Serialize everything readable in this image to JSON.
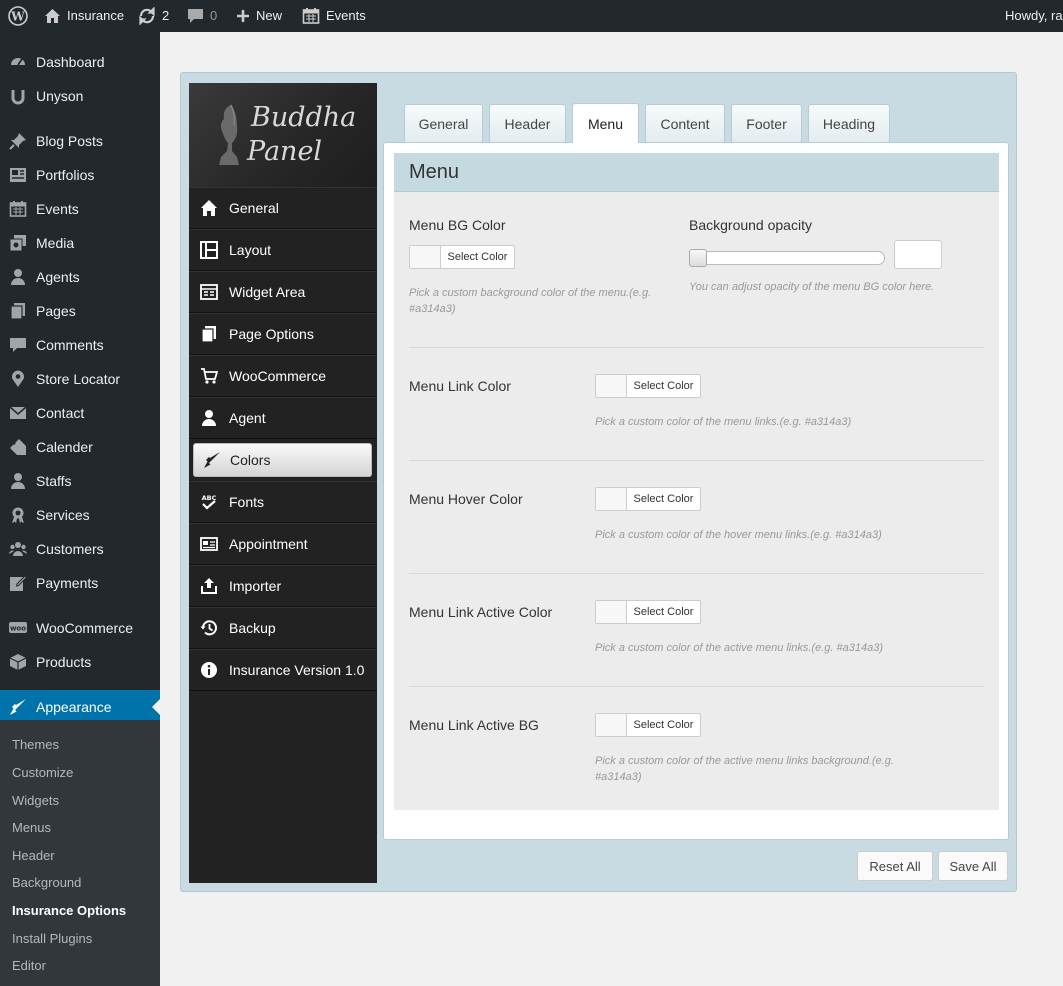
{
  "adminbar": {
    "site_name": "Insurance",
    "updates_count": "2",
    "comments_count": "0",
    "new_label": "New",
    "events_label": "Events",
    "howdy": "Howdy, ra"
  },
  "admin_menu": {
    "items": [
      {
        "label": "Dashboard",
        "icon": "dashboard-icon"
      },
      {
        "label": "Unyson",
        "icon": "unyson-icon"
      },
      {
        "label": "Blog Posts",
        "icon": "pin-icon"
      },
      {
        "label": "Portfolios",
        "icon": "portfolio-icon"
      },
      {
        "label": "Events",
        "icon": "calendar-icon"
      },
      {
        "label": "Media",
        "icon": "media-icon"
      },
      {
        "label": "Agents",
        "icon": "user-icon"
      },
      {
        "label": "Pages",
        "icon": "pages-icon"
      },
      {
        "label": "Comments",
        "icon": "comment-icon"
      },
      {
        "label": "Store Locator",
        "icon": "location-icon"
      },
      {
        "label": "Contact",
        "icon": "email-icon"
      },
      {
        "label": "Calender",
        "icon": "tag-icon"
      },
      {
        "label": "Staffs",
        "icon": "user-icon"
      },
      {
        "label": "Services",
        "icon": "award-icon"
      },
      {
        "label": "Customers",
        "icon": "groups-icon"
      },
      {
        "label": "Payments",
        "icon": "edit-icon"
      },
      {
        "label": "WooCommerce",
        "icon": "woo-icon"
      },
      {
        "label": "Products",
        "icon": "cube-icon"
      },
      {
        "label": "Appearance",
        "icon": "brush-icon"
      }
    ],
    "submenu": [
      "Themes",
      "Customize",
      "Widgets",
      "Menus",
      "Header",
      "Background",
      "Insurance Options",
      "Install Plugins",
      "Editor"
    ],
    "current_submenu": "Insurance Options"
  },
  "panel": {
    "logo_line1": "Buddha",
    "logo_line2": "Panel",
    "nav": [
      {
        "label": "General",
        "icon": "home-icon"
      },
      {
        "label": "Layout",
        "icon": "layout-icon"
      },
      {
        "label": "Widget Area",
        "icon": "widget-icon"
      },
      {
        "label": "Page Options",
        "icon": "pages-icon"
      },
      {
        "label": "WooCommerce",
        "icon": "cart-icon"
      },
      {
        "label": "Agent",
        "icon": "user-icon"
      },
      {
        "label": "Colors",
        "icon": "brush-icon"
      },
      {
        "label": "Fonts",
        "icon": "spellcheck-icon"
      },
      {
        "label": "Appointment",
        "icon": "card-icon"
      },
      {
        "label": "Importer",
        "icon": "upload-icon"
      },
      {
        "label": "Backup",
        "icon": "history-icon"
      },
      {
        "label": "Insurance Version 1.0",
        "icon": "info-icon"
      }
    ],
    "active_nav": "Colors",
    "tabs": [
      "General",
      "Header",
      "Menu",
      "Content",
      "Footer",
      "Heading"
    ],
    "active_tab": "Menu",
    "section_title": "Menu",
    "options": {
      "bg_color": {
        "label": "Menu BG Color",
        "button": "Select Color",
        "desc": "Pick a custom background color of the menu.(e.g. #a314a3)"
      },
      "opacity": {
        "label": "Background opacity",
        "desc": "You can adjust opacity of the menu BG color here."
      },
      "link_color": {
        "label": "Menu Link Color",
        "button": "Select Color",
        "desc": "Pick a custom color of the menu links.(e.g. #a314a3)"
      },
      "hover_color": {
        "label": "Menu Hover Color",
        "button": "Select Color",
        "desc": "Pick a custom color of the hover menu links.(e.g. #a314a3)"
      },
      "active_color": {
        "label": "Menu Link Active Color",
        "button": "Select Color",
        "desc": "Pick a custom color of the active menu links.(e.g. #a314a3)"
      },
      "active_bg": {
        "label": "Menu Link Active BG",
        "button": "Select Color",
        "desc": "Pick a custom color of the active menu links background.(e.g. #a314a3)"
      }
    },
    "reset_label": "Reset All",
    "save_label": "Save All"
  },
  "colors": {
    "admin_dark": "#23282d",
    "admin_accent": "#0073aa",
    "panel_bg": "#c9dbe2"
  }
}
